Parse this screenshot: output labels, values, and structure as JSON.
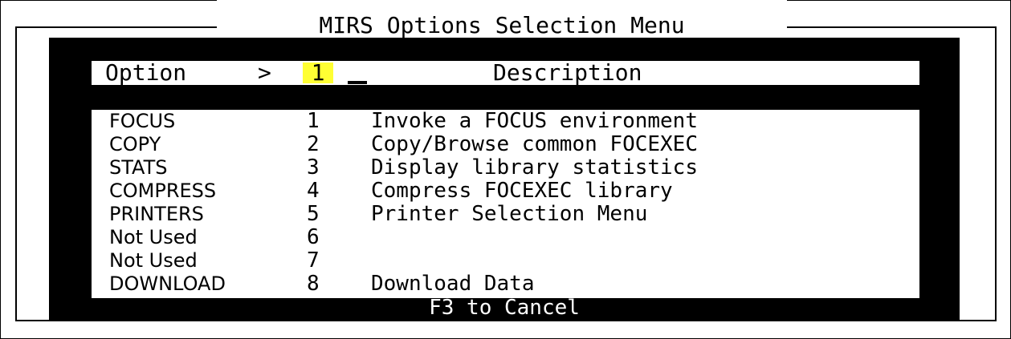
{
  "window": {
    "title": "MIRS Options Selection Menu"
  },
  "header": {
    "option_label": "Option",
    "prompt": ">",
    "option_value": "1",
    "description_label": "Description"
  },
  "options": [
    {
      "name": "FOCUS",
      "number": "1",
      "description": "Invoke a FOCUS environment"
    },
    {
      "name": "COPY",
      "number": "2",
      "description": "Copy/Browse common FOCEXEC"
    },
    {
      "name": "STATS",
      "number": "3",
      "description": "Display library statistics"
    },
    {
      "name": "COMPRESS",
      "number": "4",
      "description": "Compress FOCEXEC library"
    },
    {
      "name": "PRINTERS",
      "number": "5",
      "description": "Printer Selection Menu"
    },
    {
      "name": "Not Used",
      "number": "6",
      "description": ""
    },
    {
      "name": "Not Used",
      "number": "7",
      "description": ""
    },
    {
      "name": "DOWNLOAD",
      "number": "8",
      "description": "Download Data"
    }
  ],
  "footer": {
    "text": "F3 to Cancel"
  },
  "colors": {
    "background": "#ffffff",
    "screen": "#000000",
    "highlight": "#ffff33",
    "footer_text": "#ffffff"
  }
}
